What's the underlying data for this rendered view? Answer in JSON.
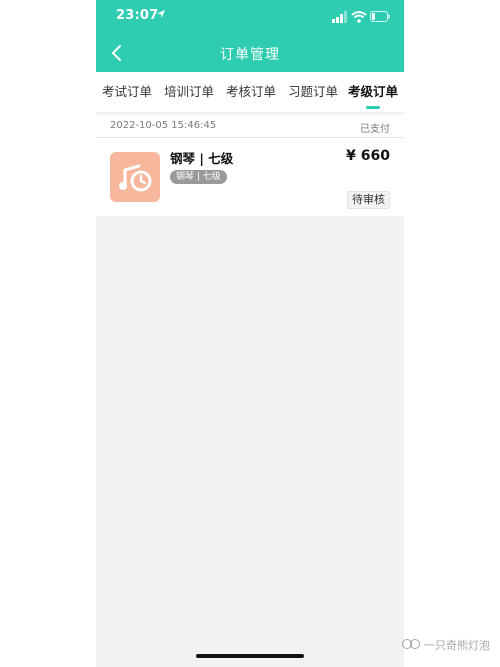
{
  "status_bar": {
    "time": "23:07"
  },
  "header": {
    "title": "订单管理"
  },
  "tabs": [
    {
      "label": "考试订单"
    },
    {
      "label": "培训订单"
    },
    {
      "label": "考核订单"
    },
    {
      "label": "习题订单"
    },
    {
      "label": "考级订单"
    }
  ],
  "active_tab": "考级订单",
  "orders": [
    {
      "time": "2022-10-05 15:46:45",
      "payment_status": "已支付",
      "product_name": "钢琴 | 七级",
      "tag": "钢琴 | 七级",
      "price": "¥ 660",
      "review_status": "待审核"
    }
  ],
  "watermark": {
    "text": "一只奇熊灯泡"
  },
  "colors": {
    "accent": "#2ecdb1",
    "thumbnail": "#f7b79c"
  }
}
